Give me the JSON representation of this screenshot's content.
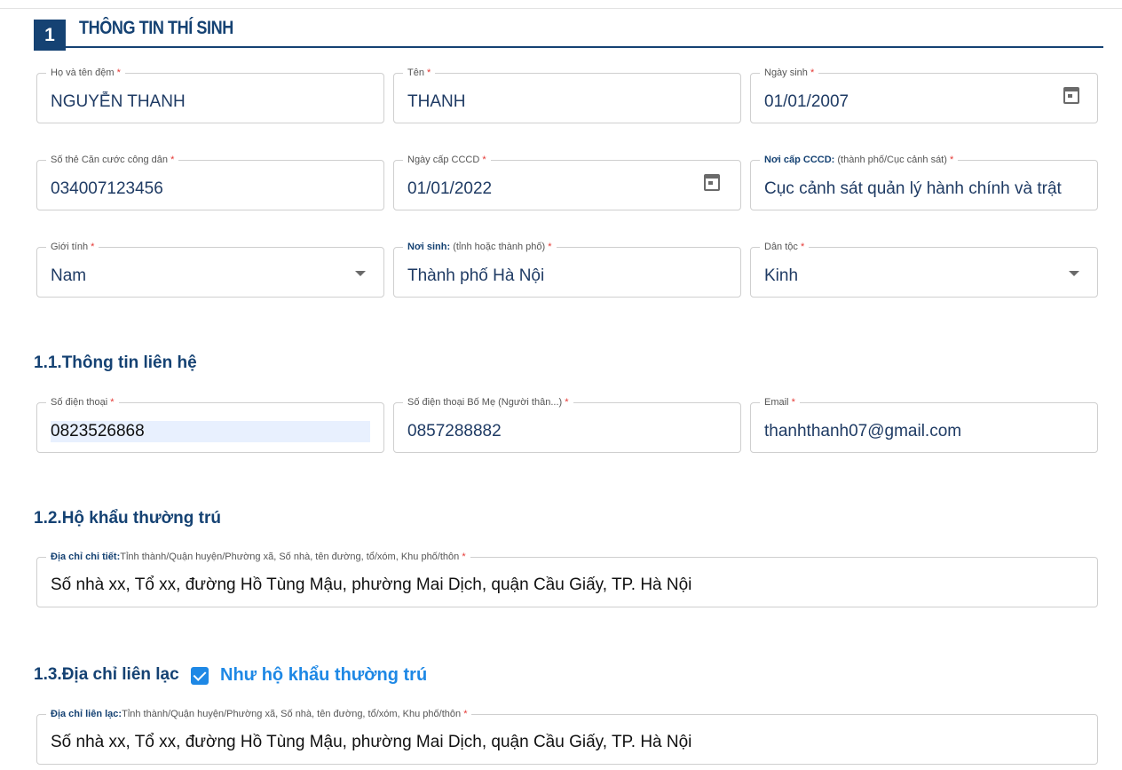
{
  "section": {
    "number": "1",
    "title": "THÔNG TIN THÍ SINH"
  },
  "fields": {
    "ho_dem": {
      "label": "Họ và tên đệm",
      "required": "*",
      "value": "NGUYỄN THANH"
    },
    "ten": {
      "label": "Tên",
      "required": "*",
      "value": "THANH"
    },
    "ngay_sinh": {
      "label": "Ngày sinh",
      "required": "*",
      "value": "01/01/2007",
      "icon": "calendar-icon"
    },
    "cccd": {
      "label": "Số thẻ Căn cước công dân",
      "required": "*",
      "value": "034007123456"
    },
    "ngay_cap": {
      "label": "Ngày cấp CCCD",
      "required": "*",
      "value": "01/01/2022",
      "icon": "calendar-icon"
    },
    "noi_cap": {
      "label_bold": "Nơi cấp CCCD:",
      "label": " (thành phố/Cục cảnh sát)",
      "required": "*",
      "value": "Cục cảnh sát quản lý hành chính và trật"
    },
    "gioi_tinh": {
      "label": "Giới tính",
      "required": "*",
      "value": "Nam",
      "icon": "chevron-down-icon"
    },
    "noi_sinh": {
      "label_bold": "Nơi sinh:",
      "label": " (tỉnh hoặc thành phố)",
      "required": "*",
      "value": "Thành phố Hà Nội"
    },
    "dan_toc": {
      "label": "Dân tộc",
      "required": "*",
      "value": "Kinh",
      "icon": "chevron-down-icon"
    }
  },
  "contact": {
    "heading": "1.1.Thông tin liên hệ",
    "phone": {
      "label": "Số điện thoại",
      "required": "*",
      "value": "0823526868"
    },
    "parent_phone": {
      "label": "Số điện thoại Bố Mẹ (Người thân...)",
      "required": "*",
      "value": "0857288882"
    },
    "email": {
      "label": "Email",
      "required": "*",
      "value": "thanhthanh07@gmail.com"
    }
  },
  "household": {
    "heading": "1.2.Hộ khẩu thường trú",
    "address": {
      "label_bold": "Địa chỉ chi tiết:",
      "label": "Tỉnh thành/Quận huyện/Phường xã, Số nhà, tên đường, tổ/xóm, Khu phố/thôn",
      "required": "*",
      "value": "Số nhà xx, Tổ xx, đường Hồ Tùng Mậu, phường Mai Dịch, quận Cầu Giấy, TP. Hà Nội"
    }
  },
  "mailing": {
    "heading": "1.3.Địa chỉ liên lạc",
    "same_as_label": "Như hộ khẩu thường trú",
    "same_as_checked": true,
    "address": {
      "label_bold": "Địa chỉ liên lạc:",
      "label": "Tỉnh thành/Quận huyện/Phường xã, Số nhà, tên đường, tổ/xóm, Khu phố/thôn",
      "required": "*",
      "value": "Số nhà xx, Tổ xx, đường Hồ Tùng Mậu, phường Mai Dịch, quận Cầu Giấy, TP. Hà Nội"
    }
  },
  "colors": {
    "primary": "#154273",
    "accent": "#1e88e5",
    "required": "#e53935",
    "border": "#cfcfcf"
  }
}
